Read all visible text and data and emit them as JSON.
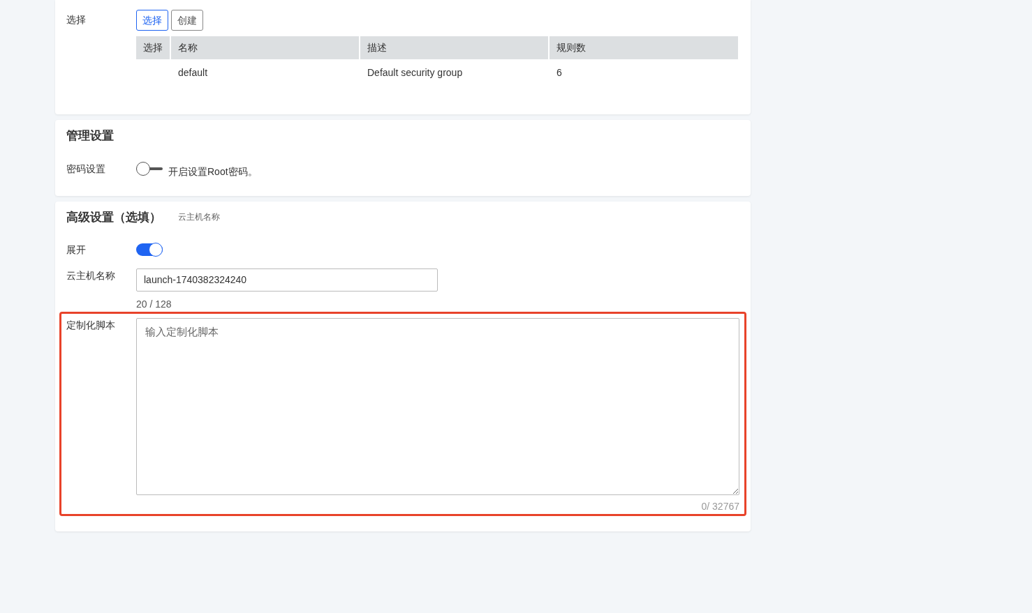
{
  "security_group": {
    "label": "选择",
    "buttons": [
      {
        "label": "选择",
        "selected": true
      },
      {
        "label": "创建",
        "selected": false
      }
    ],
    "table": {
      "columns": [
        "选择",
        "名称",
        "描述",
        "规则数"
      ],
      "rows": [
        {
          "cells": [
            "",
            "default",
            "Default security group",
            "6"
          ]
        }
      ]
    }
  },
  "management": {
    "title": "管理设置",
    "password": {
      "label": "密码设置",
      "on": false,
      "text": "开启设置Root密码。"
    }
  },
  "advanced": {
    "title": "高级设置（选填）",
    "subtitle": "云主机名称",
    "expand": {
      "label": "展开",
      "on": true
    },
    "instance_name": {
      "label": "云主机名称",
      "value": "launch-1740382324240",
      "counter": "20 / 128"
    },
    "script": {
      "label": "定制化脚本",
      "placeholder": "输入定制化脚本",
      "counter": "0/ 32767",
      "highlighted": true
    }
  }
}
